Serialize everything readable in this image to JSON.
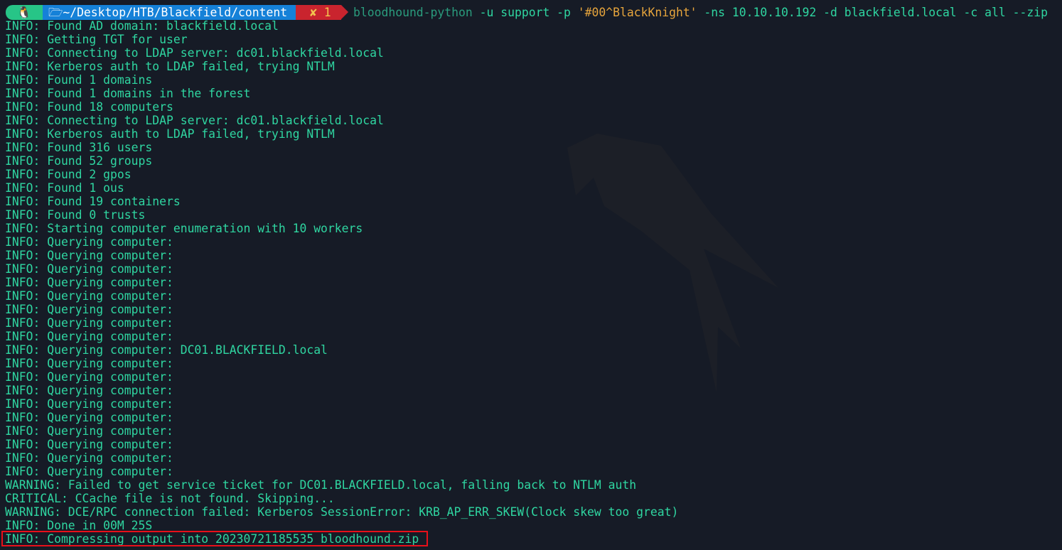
{
  "prompt": {
    "os_icon": "penguin-icon",
    "folder_icon": "folder-open-icon",
    "path": "~/Desktop/HTB/Blackfield/content",
    "status": "✘ 1",
    "command_exe": "bloodhound-python",
    "command_pre": " -u support -p ",
    "command_pass": "'#00^BlackKnight'",
    "command_post": " -ns 10.10.10.192 -d blackfield.local -c all --zip"
  },
  "colors": {
    "background": "#161b26",
    "output_text": "#2fd6a1",
    "segment_os": "#27c587",
    "segment_path": "#1581d8",
    "segment_status": "#c9242e",
    "highlight_border": "#e8101a"
  },
  "output": [
    "INFO: Found AD domain: blackfield.local",
    "INFO: Getting TGT for user",
    "INFO: Connecting to LDAP server: dc01.blackfield.local",
    "INFO: Kerberos auth to LDAP failed, trying NTLM",
    "INFO: Found 1 domains",
    "INFO: Found 1 domains in the forest",
    "INFO: Found 18 computers",
    "INFO: Connecting to LDAP server: dc01.blackfield.local",
    "INFO: Kerberos auth to LDAP failed, trying NTLM",
    "INFO: Found 316 users",
    "INFO: Found 52 groups",
    "INFO: Found 2 gpos",
    "INFO: Found 1 ous",
    "INFO: Found 19 containers",
    "INFO: Found 0 trusts",
    "INFO: Starting computer enumeration with 10 workers",
    "INFO: Querying computer:",
    "INFO: Querying computer:",
    "INFO: Querying computer:",
    "INFO: Querying computer:",
    "INFO: Querying computer:",
    "INFO: Querying computer:",
    "INFO: Querying computer:",
    "INFO: Querying computer:",
    "INFO: Querying computer: DC01.BLACKFIELD.local",
    "INFO: Querying computer:",
    "INFO: Querying computer:",
    "INFO: Querying computer:",
    "INFO: Querying computer:",
    "INFO: Querying computer:",
    "INFO: Querying computer:",
    "INFO: Querying computer:",
    "INFO: Querying computer:",
    "INFO: Querying computer:",
    "WARNING: Failed to get service ticket for DC01.BLACKFIELD.local, falling back to NTLM auth",
    "CRITICAL: CCache file is not found. Skipping...",
    "WARNING: DCE/RPC connection failed: Kerberos SessionError: KRB_AP_ERR_SKEW(Clock skew too great)",
    "INFO: Done in 00M 25S",
    "INFO: Compressing output into 20230721185535_bloodhound.zip"
  ]
}
